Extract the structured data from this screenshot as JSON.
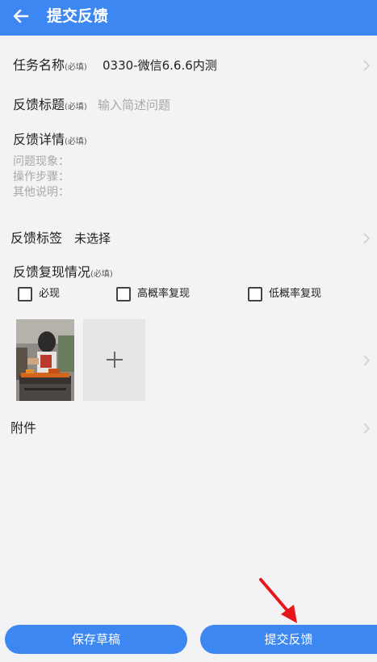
{
  "header": {
    "title": "提交反馈"
  },
  "task": {
    "label": "任务名称",
    "required": "(必填)",
    "value": "0330-微信6.6.6内测"
  },
  "feedback_title": {
    "label": "反馈标题",
    "required": "(必填)",
    "placeholder": "输入简述问题"
  },
  "details": {
    "label": "反馈详情",
    "required": "(必填)",
    "placeholder_lines": [
      "问题现象：",
      "操作步骤：",
      "其他说明："
    ]
  },
  "tag": {
    "label": "反馈标签",
    "value": "未选择"
  },
  "reproduce": {
    "label": "反馈复现情况",
    "required": "(必填)",
    "options": [
      {
        "label": "必现",
        "checked": false
      },
      {
        "label": "高概率复现",
        "checked": false
      },
      {
        "label": "低概率复现",
        "checked": false
      }
    ]
  },
  "attachment": {
    "label": "附件"
  },
  "footer": {
    "save_label": "保存草稿",
    "submit_label": "提交反馈"
  },
  "colors": {
    "accent": "#3d87f3",
    "background": "#f3f3f5",
    "annotation_arrow": "#e8161c"
  },
  "icons": {
    "back": "arrow-left-icon",
    "chevron": "chevron-right-icon",
    "add": "plus-icon"
  }
}
